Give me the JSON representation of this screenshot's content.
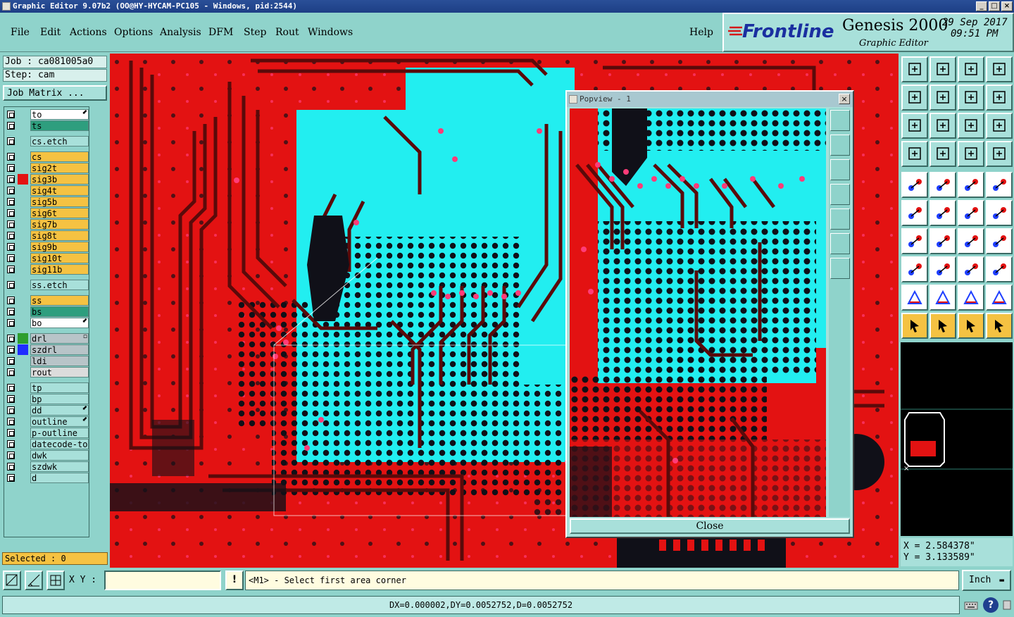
{
  "window": {
    "title": "Graphic Editor 9.07b2 (OO@HY-HYCAM-PC105 - Windows, pid:2544)",
    "minimize": "_",
    "maximize": "□",
    "close": "×"
  },
  "menu": {
    "items": [
      "File",
      "Edit",
      "Actions",
      "Options",
      "Analysis",
      "DFM",
      "Step",
      "Rout",
      "Windows"
    ],
    "help": "Help"
  },
  "brand": {
    "logo": "Frontline",
    "product": "Genesis 2000",
    "subtitle": "Graphic Editor",
    "date": "29 Sep 2017",
    "time": "09:51 PM"
  },
  "job": {
    "job_line": "Job : ca081005a0",
    "step_line": "Step: cam",
    "matrix_button": "Job Matrix ..."
  },
  "layers": [
    {
      "name": "to",
      "bg": "#ffffff",
      "mark": "⬋"
    },
    {
      "name": "ts",
      "bg": "#2e9e7e",
      "mark": ""
    },
    {
      "name": "cs.etch",
      "bg": "#a8e0da",
      "mark": ""
    },
    {
      "name": "cs",
      "bg": "#f5c242",
      "mark": ""
    },
    {
      "name": "sig2t",
      "bg": "#f5c242",
      "mark": ""
    },
    {
      "name": "sig3b",
      "bg": "#f5c242",
      "mark": "",
      "active": "#e31212"
    },
    {
      "name": "sig4t",
      "bg": "#f5c242",
      "mark": ""
    },
    {
      "name": "sig5b",
      "bg": "#f5c242",
      "mark": ""
    },
    {
      "name": "sig6t",
      "bg": "#f5c242",
      "mark": ""
    },
    {
      "name": "sig7b",
      "bg": "#f5c242",
      "mark": ""
    },
    {
      "name": "sig8t",
      "bg": "#f5c242",
      "mark": ""
    },
    {
      "name": "sig9b",
      "bg": "#f5c242",
      "mark": ""
    },
    {
      "name": "sig10t",
      "bg": "#f5c242",
      "mark": ""
    },
    {
      "name": "sig11b",
      "bg": "#f5c242",
      "mark": ""
    },
    {
      "name": "ss.etch",
      "bg": "#a8e0da",
      "mark": ""
    },
    {
      "name": "ss",
      "bg": "#f5c242",
      "mark": ""
    },
    {
      "name": "bs",
      "bg": "#2e9e7e",
      "mark": ""
    },
    {
      "name": "bo",
      "bg": "#ffffff",
      "mark": "⬋"
    },
    {
      "name": "drl",
      "bg": "#b8c4c8",
      "mark": "▫",
      "active": "#2e9e2e"
    },
    {
      "name": "szdrl",
      "bg": "#b8c4c8",
      "mark": "",
      "active": "#1f2cff"
    },
    {
      "name": "ldi",
      "bg": "#b8c4c8",
      "mark": ""
    },
    {
      "name": "rout",
      "bg": "#dcdcdc",
      "mark": ""
    },
    {
      "name": "tp",
      "bg": "#a8e0da",
      "mark": ""
    },
    {
      "name": "bp",
      "bg": "#a8e0da",
      "mark": ""
    },
    {
      "name": "dd",
      "bg": "#a8e0da",
      "mark": "⬋"
    },
    {
      "name": "outline",
      "bg": "#a8e0da",
      "mark": "⬋"
    },
    {
      "name": "p-outline",
      "bg": "#a8e0da",
      "mark": ""
    },
    {
      "name": "datecode-to",
      "bg": "#a8e0da",
      "mark": ""
    },
    {
      "name": "dwk",
      "bg": "#a8e0da",
      "mark": ""
    },
    {
      "name": "szdwk",
      "bg": "#a8e0da",
      "mark": ""
    },
    {
      "name": "d",
      "bg": "#a8e0da",
      "mark": ""
    }
  ],
  "selection": {
    "label": "Selected : 0"
  },
  "popview": {
    "title": "Popview - 1",
    "close_x": "×",
    "close_button": "Close"
  },
  "coords": {
    "x": "X = 2.584378\"",
    "y": "Y = 3.133589\""
  },
  "command": {
    "xy_label": "X Y :",
    "input_value": "",
    "prompt": "<M1> - Select first area corner",
    "units": "Inch"
  },
  "status": {
    "measure": "DX=0.000002,DY=0.0052752,D=0.0052752"
  },
  "colors": {
    "board_red": "#e31212",
    "cyan_plane": "#22eef0",
    "trace_dark": "#5a0a0a",
    "pad_black": "#101018",
    "via_pink": "#ff3c78",
    "panel_teal": "#8fd3cb"
  }
}
